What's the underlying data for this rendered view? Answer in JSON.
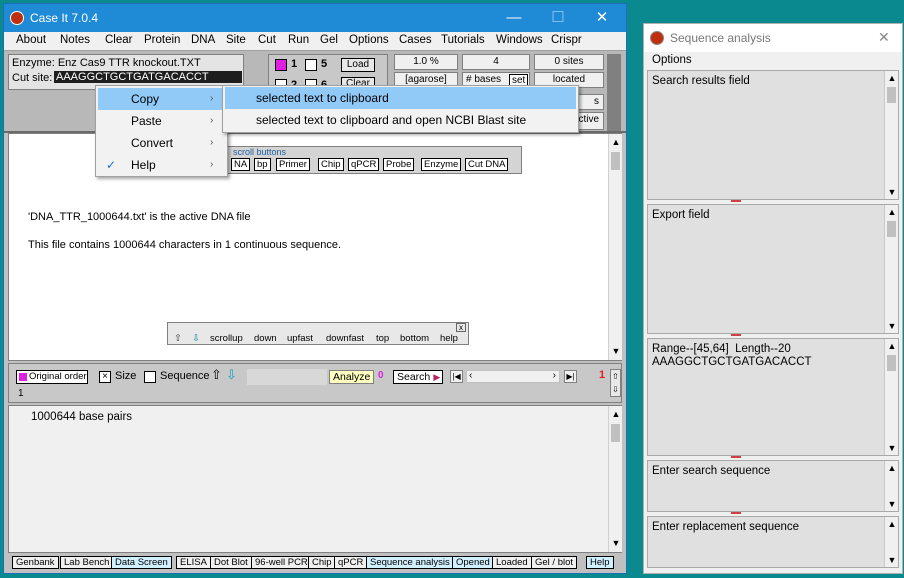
{
  "main_window": {
    "title": "Case It 7.0.4",
    "controls": {
      "minimize": "—",
      "maximize": "☐",
      "close": "✕"
    },
    "menu": [
      "About",
      "Notes",
      "Clear",
      "Protein",
      "DNA",
      "Site",
      "Cut",
      "Run",
      "Gel",
      "Options",
      "Cases",
      "Tutorials",
      "Windows",
      "Crispr"
    ]
  },
  "top_panel": {
    "enzyme_label": "Enzyme: Enz Cas9 TTR knockout.TXT",
    "cut_site_label": "Cut site:",
    "cut_site_value": "AAAGGCTGCTGATGACACCT",
    "lane_numbers": [
      "1",
      "5",
      "2",
      "6"
    ],
    "load_btn": "Load",
    "clear_btn": "Clear",
    "percent": "1.0 %",
    "agarose": "[agarose]",
    "bases_count": "4",
    "bases_label": "# bases",
    "set_btn": "set",
    "sites": "0  sites",
    "located": "located",
    "s_frag": "s",
    "ctive_frag": "ctive"
  },
  "context_menu": {
    "items": [
      {
        "label": "Copy",
        "arrow": "›",
        "check": ""
      },
      {
        "label": "Paste",
        "arrow": "›",
        "check": ""
      },
      {
        "label": "Convert",
        "arrow": "›",
        "check": ""
      },
      {
        "label": "Help",
        "arrow": "›",
        "check": "✓"
      }
    ],
    "submenu": [
      "selected text to clipboard",
      "selected text to clipboard and open NCBI Blast site"
    ]
  },
  "content": {
    "btn_bar_label": "scroll buttons",
    "buttons": [
      "NA",
      "bp",
      "Primer",
      "Chip",
      "qPCR",
      "Probe",
      "Enzyme",
      "Cut DNA"
    ],
    "line1": "'DNA_TTR_1000644.txt' is the active DNA file",
    "line2": "This file contains 1000644 characters in 1 continuous sequence.",
    "scroll_panel": [
      "scrollup",
      "down",
      "upfast",
      "downfast",
      "top",
      "bottom",
      "help"
    ]
  },
  "bar2": {
    "original_order": "Original order",
    "size": "Size",
    "sequence": "Sequence",
    "analyze": "Analyze",
    "zero": "0",
    "search": "Search",
    "page_number": "1",
    "line_number": "1"
  },
  "bottom": {
    "text": "1000644 base pairs"
  },
  "status_bar": [
    "Genbank",
    "Lab Bench",
    "Data Screen",
    "ELISA",
    "Dot Blot",
    "96-well PCR",
    "Chip",
    "qPCR",
    "Sequence analysis",
    "Opened",
    "Loaded",
    "Gel / blot",
    "Help"
  ],
  "seq_window": {
    "title": "Sequence analysis",
    "close": "✕",
    "menu": "Options",
    "fields": [
      "Search results field",
      "Export field",
      "Range--[45,64]  Length--20\nAAAGGCTGCTGATGACACCT",
      "Enter search sequence",
      "Enter replacement sequence"
    ]
  },
  "colors": {
    "titlebar": "#1f8ad6",
    "desktop": "#0a8a8f",
    "highlight": "#91c9f7",
    "magenta": "#e020e0"
  }
}
